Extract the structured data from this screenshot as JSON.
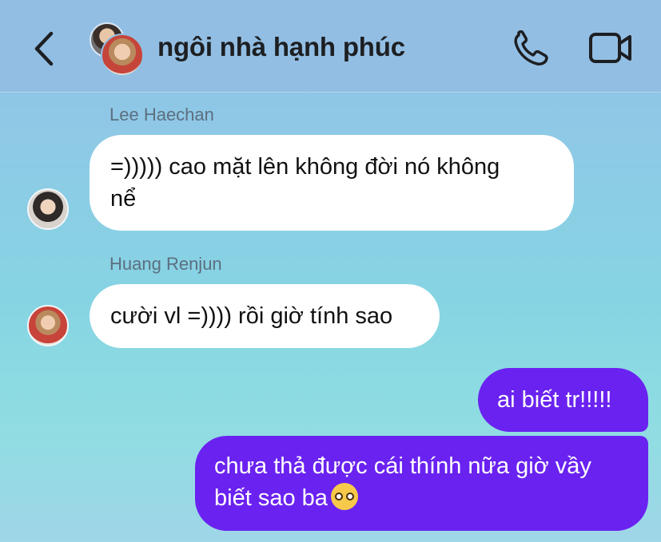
{
  "header": {
    "title": "ngôi nhà hạnh phúc",
    "back_icon": "chevron-left-icon",
    "call_icon": "phone-icon",
    "video_icon": "video-camera-icon"
  },
  "messages": [
    {
      "sender": "Lee Haechan",
      "text": "=))))) cao mặt lên không đời nó không\nnể",
      "direction": "incoming"
    },
    {
      "sender": "Huang Renjun",
      "text": "cười vl =)))) rồi giờ tính sao",
      "direction": "incoming"
    },
    {
      "text": "ai biết tr!!!!!",
      "direction": "outgoing"
    },
    {
      "text": "chưa thả được cái thính nữa giờ vầy\nbiết sao ba",
      "emoji": "pleading-face-emoji",
      "direction": "outgoing"
    }
  ],
  "colors": {
    "header_bg": "#93bee3",
    "outgoing_bubble": "#6a22f0",
    "incoming_bubble": "#ffffff",
    "sender_name": "#5c6f80"
  }
}
